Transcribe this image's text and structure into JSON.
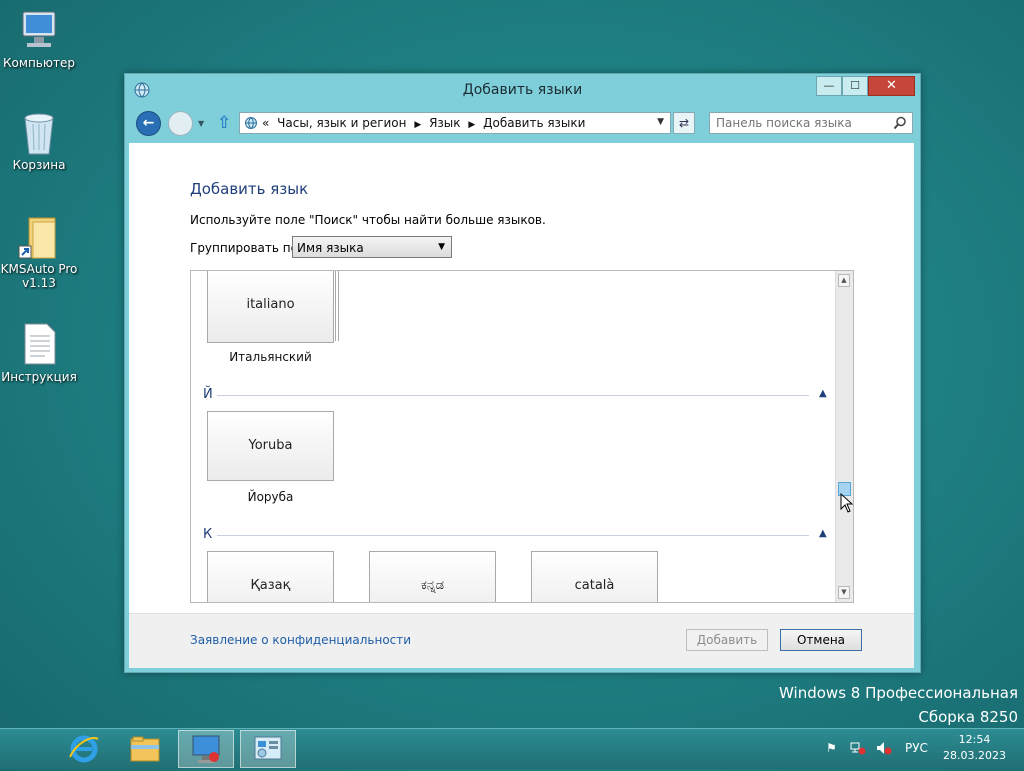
{
  "desktop": {
    "icons": [
      {
        "label": "Компьютер"
      },
      {
        "label": "Корзина"
      },
      {
        "label": "KMSAuto Pro v1.13"
      },
      {
        "label": "Инструкция"
      }
    ],
    "watermark_line1": "Windows 8 Профессиональная",
    "watermark_line2": "Сборка 8250"
  },
  "window": {
    "title": "Добавить языки",
    "controls": {
      "minimize": "—",
      "maximize": "☐",
      "close": "✕"
    },
    "address": {
      "prefix": "«",
      "crumbs": [
        "Часы, язык и регион",
        "Язык",
        "Добавить языки"
      ]
    },
    "search": {
      "placeholder": "Панель поиска языка"
    },
    "heading": "Добавить язык",
    "description": "Используйте поле \"Поиск\" чтобы найти больше языков.",
    "group_by_label": "Группировать по:",
    "group_by_value": "Имя языка",
    "groups": [
      {
        "letter": "Й"
      },
      {
        "letter": "К"
      }
    ],
    "tiles": [
      {
        "name": "italiano",
        "caption": "Итальянский"
      },
      {
        "name": "Yoruba",
        "caption": "Йоруба"
      },
      {
        "name": "Қазақ",
        "caption": ""
      },
      {
        "name": "ಕನ್ನಡ",
        "caption": ""
      },
      {
        "name": "català",
        "caption": ""
      }
    ],
    "footer": {
      "privacy_link": "Заявление о конфиденциальности",
      "add_button": "Добавить",
      "cancel_button": "Отмена"
    }
  },
  "taskbar": {
    "language": "РУС",
    "time": "12:54",
    "date": "28.03.2023"
  },
  "colors": {
    "window_frame": "#7fcfda",
    "link_blue": "#1f5fa8",
    "heading_blue": "#1f3f7a",
    "close_red": "#c7463a"
  }
}
